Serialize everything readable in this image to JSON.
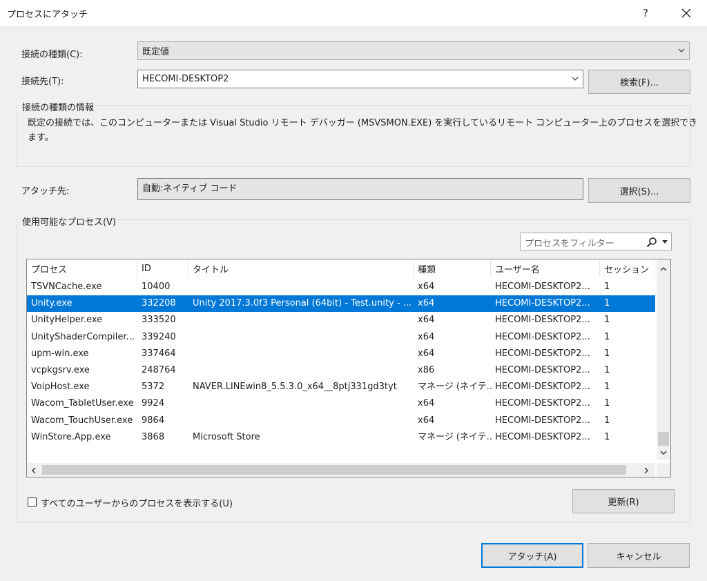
{
  "window": {
    "title": "プロセスにアタッチ",
    "help": "?",
    "close": "✕"
  },
  "connection_type": {
    "label": "接続の種類(C):",
    "value": "既定値"
  },
  "connection_target": {
    "label": "接続先(T):",
    "value": "HECOMI-DESKTOP2",
    "find_button": "検索(F)..."
  },
  "info": {
    "title": "接続の種類の情報",
    "line1": "既定の接続では、このコンピューターまたは Visual Studio リモート デバッガー (MSVSMON.EXE) を実行しているリモート コンピューター上のプロセスを選択でき",
    "line2": "ます。"
  },
  "attach_to": {
    "label": "アタッチ先:",
    "value": "自動:ネイティブ コード",
    "select_button": "選択(S)..."
  },
  "processes": {
    "group_title": "使用可能なプロセス(V)",
    "filter_placeholder": "プロセスをフィルター",
    "columns": [
      "プロセス",
      "ID",
      "タイトル",
      "種類",
      "ユーザー名",
      "セッション"
    ],
    "rows": [
      {
        "process": "TSVNCache.exe",
        "id": "10400",
        "title": "",
        "type": "x64",
        "user": "HECOMI-DESKTOP2...",
        "session": "1"
      },
      {
        "process": "Unity.exe",
        "id": "332208",
        "title": "Unity 2017.3.0f3 Personal (64bit) - Test.unity - ...",
        "type": "x64",
        "user": "HECOMI-DESKTOP2...",
        "session": "1"
      },
      {
        "process": "UnityHelper.exe",
        "id": "333520",
        "title": "",
        "type": "x64",
        "user": "HECOMI-DESKTOP2...",
        "session": "1"
      },
      {
        "process": "UnityShaderCompiler...",
        "id": "339240",
        "title": "",
        "type": "x64",
        "user": "HECOMI-DESKTOP2...",
        "session": "1"
      },
      {
        "process": "upm-win.exe",
        "id": "337464",
        "title": "",
        "type": "x64",
        "user": "HECOMI-DESKTOP2...",
        "session": "1"
      },
      {
        "process": "vcpkgsrv.exe",
        "id": "248764",
        "title": "",
        "type": "x86",
        "user": "HECOMI-DESKTOP2...",
        "session": "1"
      },
      {
        "process": "VoipHost.exe",
        "id": "5372",
        "title": "NAVER.LINEwin8_5.5.3.0_x64__8ptj331gd3tyt",
        "type": "マネージ (ネイテ...",
        "user": "HECOMI-DESKTOP2...",
        "session": "1"
      },
      {
        "process": "Wacom_TabletUser.exe",
        "id": "9924",
        "title": "",
        "type": "x64",
        "user": "HECOMI-DESKTOP2...",
        "session": "1"
      },
      {
        "process": "Wacom_TouchUser.exe",
        "id": "9864",
        "title": "",
        "type": "x64",
        "user": "HECOMI-DESKTOP2...",
        "session": "1"
      },
      {
        "process": "WinStore.App.exe",
        "id": "3868",
        "title": "Microsoft Store",
        "type": "マネージ (ネイテ...",
        "user": "HECOMI-DESKTOP2...",
        "session": "1"
      }
    ],
    "selected_row": 1,
    "show_all_users_label": "すべてのユーザーからのプロセスを表示する(U)",
    "refresh_button": "更新(R)"
  },
  "footer": {
    "attach_button": "アタッチ(A)",
    "cancel_button": "キャンセル"
  },
  "colors": {
    "accent": "#0078d7",
    "background": "#f0f0f0"
  },
  "icons": {
    "filter": "search-icon",
    "dropdown": "chevron-down-icon"
  }
}
